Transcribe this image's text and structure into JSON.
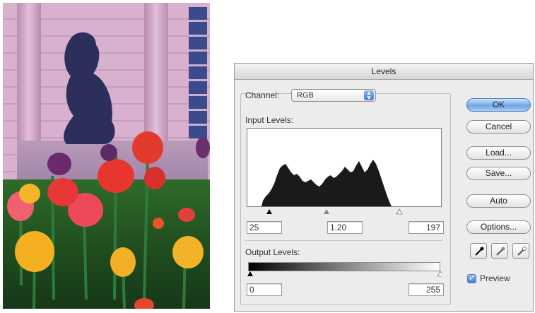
{
  "dialog": {
    "title": "Levels",
    "channel_label": "Channel:",
    "channel_value": "RGB",
    "input_levels_label": "Input Levels:",
    "output_levels_label": "Output Levels:",
    "input_black": "25",
    "input_gamma": "1.20",
    "input_white": "197",
    "output_black": "0",
    "output_white": "255",
    "buttons": {
      "ok": "OK",
      "cancel": "Cancel",
      "load": "Load...",
      "save": "Save...",
      "auto": "Auto",
      "options": "Options..."
    },
    "eyedroppers": [
      "black-eyedropper-icon",
      "gray-eyedropper-icon",
      "white-eyedropper-icon"
    ],
    "preview_label": "Preview",
    "preview_checked": true
  },
  "colors": {
    "accent": "#6fa6e6",
    "histogram": "#1a1a1a"
  }
}
